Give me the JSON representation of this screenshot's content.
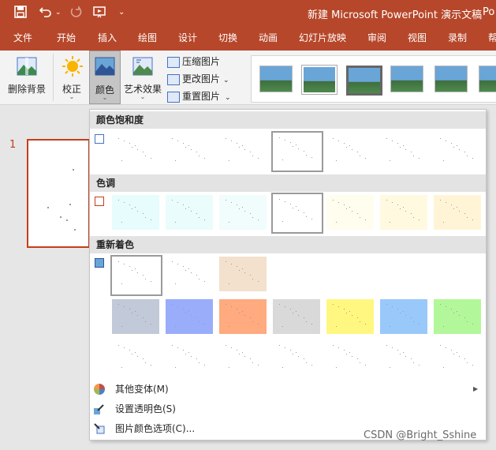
{
  "window": {
    "title": "新建 Microsoft PowerPoint 演示文稿",
    "title_overflow": "Po"
  },
  "quick_access": {
    "save_icon": "save-icon",
    "undo_icon": "undo-icon",
    "redo_icon": "redo-icon",
    "present_icon": "present-icon",
    "customize_icon": "customize-icon"
  },
  "tabs": [
    "文件",
    "开始",
    "插入",
    "绘图",
    "设计",
    "切换",
    "动画",
    "幻灯片放映",
    "审阅",
    "视图",
    "录制",
    "帮"
  ],
  "ribbon": {
    "remove_bg": "删除背景",
    "corrections": "校正",
    "color": "颜色",
    "artistic": "艺术效果",
    "compress": "压缩图片",
    "change": "更改图片",
    "reset": "重置图片"
  },
  "slide_panel": {
    "number": "1"
  },
  "dropdown": {
    "saturation_header": "颜色饱和度",
    "tone_header": "色调",
    "recolor_header": "重新着色",
    "more_variations": "其他变体(M)",
    "set_transparent": "设置透明色(S)",
    "picture_color_options": "图片颜色选项(C)..."
  },
  "colors": {
    "accent": "#b7472a",
    "tone_swatches": [
      "#e6fcfd",
      "#eafcfc",
      "#f1fcfc",
      "#ffffff",
      "#fffdee",
      "#fff9e0",
      "#fff5d6"
    ],
    "recolor_row1": [
      "#ffffff",
      "#ffffff",
      "#f3e1cd"
    ],
    "recolor_row2": [
      "#c2c9d8",
      "#99adfb",
      "#ffaa7f",
      "#d9d9d9",
      "#fff77f",
      "#99c8fb",
      "#b3f79b"
    ]
  },
  "watermark": "CSDN @Bright_Sshine"
}
